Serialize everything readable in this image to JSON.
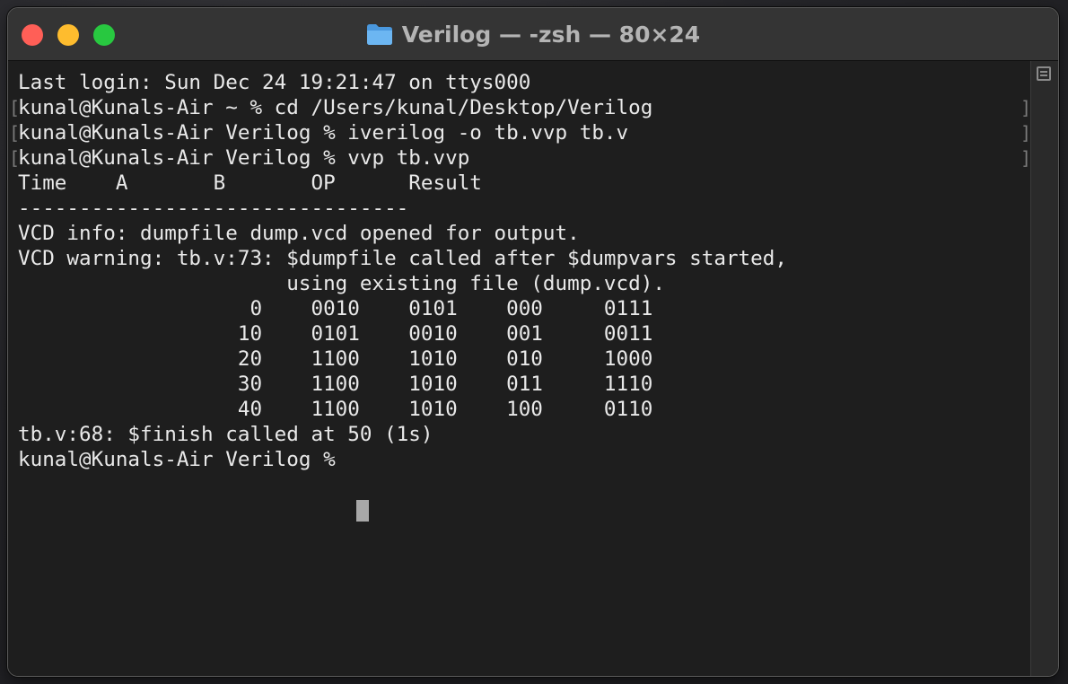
{
  "window": {
    "title": "Verilog — -zsh — 80×24"
  },
  "terminal": {
    "lines": [
      "Last login: Sun Dec 24 19:21:47 on ttys000",
      "kunal@Kunals-Air ~ % cd /Users/kunal/Desktop/Verilog",
      "kunal@Kunals-Air Verilog % iverilog -o tb.vvp tb.v",
      "kunal@Kunals-Air Verilog % vvp tb.vvp",
      "Time    A       B       OP      Result",
      "--------------------------------",
      "VCD info: dumpfile dump.vcd opened for output.",
      "VCD warning: tb.v:73: $dumpfile called after $dumpvars started,",
      "                      using existing file (dump.vcd).",
      "                   0    0010    0101    000     0111",
      "                  10    0101    0010    001     0011",
      "                  20    1100    1010    010     1000",
      "                  30    1100    1010    011     1110",
      "                  40    1100    1010    100     0110",
      "tb.v:68: $finish called at 50 (1s)",
      "kunal@Kunals-Air Verilog % "
    ],
    "marks": [
      "[",
      "]"
    ]
  },
  "colors": {
    "background": "#1e1e1e",
    "text": "#e9e9e9",
    "close": "#ff5f57",
    "minimize": "#febc2e",
    "zoom": "#28c840",
    "folder": "#5aa7e8"
  },
  "icons": {
    "folder": "folder-icon",
    "scroll": "scrollbar-toggle-icon"
  }
}
